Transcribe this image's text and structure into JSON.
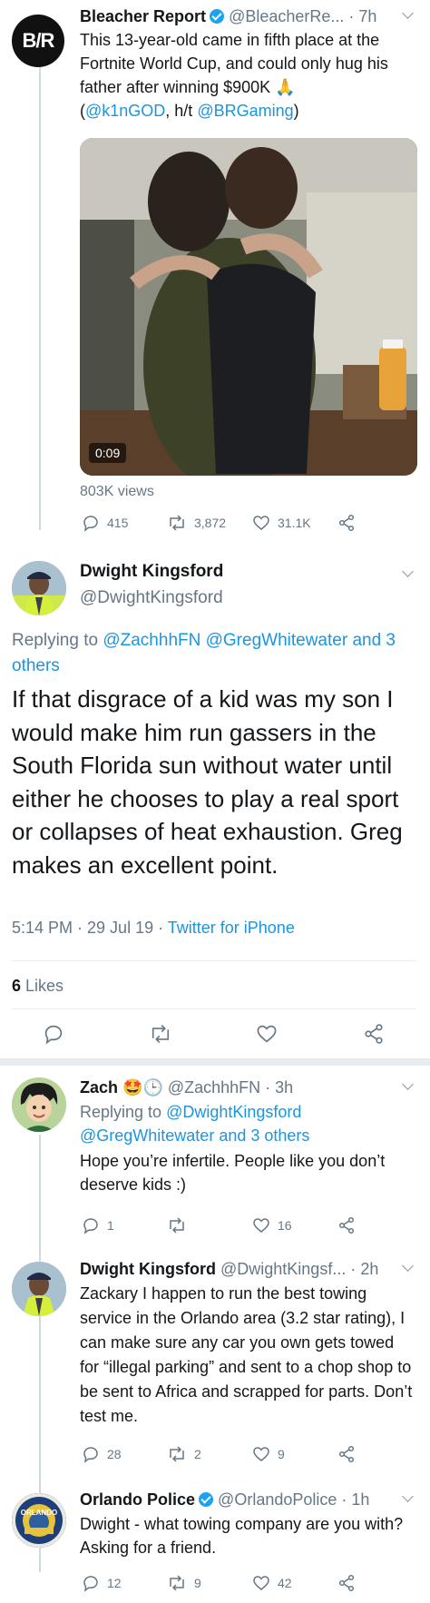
{
  "tweet1": {
    "avatar_text": "B/R",
    "name": "Bleacher Report",
    "handle": "@BleacherRe...",
    "time": "· 7h",
    "text_main": "This 13-year-old came in fifth place at the Fortnite World Cup, and could only hug his father after winning $900K",
    "emoji": "🙏",
    "credit_open": "(",
    "credit_handle1": "@k1nGOD",
    "credit_mid": ", h/t",
    "credit_handle2": "@BRGaming",
    "credit_close": ")",
    "video_duration": "0:09",
    "views": "803K views",
    "replies": "415",
    "retweets": "3,872",
    "likes": "31.1K"
  },
  "main_tweet": {
    "name": "Dwight Kingsford",
    "handle": "@DwightKingsford",
    "replying_prefix": "Replying to",
    "replying_users": "@ZachhhFN @GregWhitewater and 3",
    "replying_users_2": "others",
    "text": "If that disgrace of a kid was my son I would make him run gassers in the South Florida sun without water until either he chooses to play a real sport or collapses of heat exhaustion. Greg makes an excellent point.",
    "timestamp": "5:14 PM · 29 Jul 19 ·",
    "client": "Twitter for iPhone",
    "likes_count": "6",
    "likes_label": "Likes"
  },
  "reply1": {
    "name": "Zach",
    "emojis": "🤩🕒",
    "handle": "@ZachhhFN · 3h",
    "replying_prefix": "Replying to",
    "replying_user1": "@DwightKingsford",
    "replying_user2": "@GregWhitewater and 3 others",
    "text": "Hope you’re infertile. People like you don’t deserve kids :)",
    "replies": "1",
    "retweets": "",
    "likes": "16"
  },
  "reply2": {
    "name": "Dwight Kingsford",
    "handle": "@DwightKingsf... · 2h",
    "text": "Zackary I happen to run the best towing service in the Orlando area (3.2 star rating), I can make sure any car you own gets towed for “illegal parking” and sent to a chop shop to be sent to Africa and scrapped for parts. Don’t test me.",
    "replies": "28",
    "retweets": "2",
    "likes": "9"
  },
  "reply3": {
    "name": "Orlando Police",
    "handle": "@OrlandoPolice · 1h",
    "badge_text": "ORLANDO",
    "text": "Dwight - what towing company are you with? Asking for a friend.",
    "replies": "12",
    "retweets": "9",
    "likes": "42"
  },
  "colors": {
    "link": "#1b95e0",
    "muted": "#657786",
    "verified": "#1da1f2"
  }
}
